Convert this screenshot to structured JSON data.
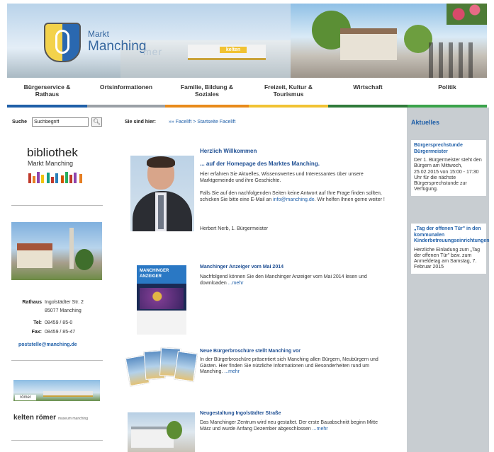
{
  "header": {
    "brand_small": "Markt",
    "brand_big": "Manching",
    "brand_ghost": "mer",
    "banner_tag": "kelten"
  },
  "nav": {
    "items": [
      {
        "label_line1": "Bürgerservice &",
        "label_line2": "Rathaus",
        "color": "#1f5fa8"
      },
      {
        "label_line1": "Ortsinformationen",
        "label_line2": "",
        "color": "#9aa0a6"
      },
      {
        "label_line1": "Familie, Bildung &",
        "label_line2": "Soziales",
        "color": "#e88a1a"
      },
      {
        "label_line1": "Freizeit, Kultur &",
        "label_line2": "Tourismus",
        "color": "#f1c232"
      },
      {
        "label_line1": "Wirtschaft",
        "label_line2": "",
        "color": "#2f7a3a"
      },
      {
        "label_line1": "Politik",
        "label_line2": "",
        "color": "#3aa34a"
      }
    ]
  },
  "search": {
    "label": "Suche",
    "value": "Suchbegriff",
    "button_icon": "search-icon"
  },
  "breadcrumb": {
    "label": "Sie sind hier:",
    "path": "»» Facelift  >  Startseite Facelift"
  },
  "library": {
    "title": "bibliothek",
    "subtitle": "Markt Manching"
  },
  "contact": {
    "rathaus_label": "Rathaus",
    "street": "Ingolstädter Str. 2",
    "city": "85077 Manching",
    "tel_label": "Tel:",
    "tel": "08459 / 85-0",
    "fax_label": "Fax:",
    "fax": "08459 / 85-47",
    "email": "poststelle@manching.de"
  },
  "kelten_roemer": {
    "sign": "römer",
    "brand": "kelten römer",
    "small": "museum manching"
  },
  "welcome": {
    "title": "Herzlich Willkommen",
    "subtitle": "... auf der Homepage des Marktes Manching.",
    "p1": "Hier erfahren Sie Aktuelles, Wissenswertes und Interessantes über unsere Marktgemeinde und ihre Geschichte.",
    "p2a": "Falls Sie auf den nachfolgenden Seiten keine Antwort auf Ihre Frage finden sollten, schicken Sie bitte eine E-Mail an",
    "p2_email": "info@manching.de",
    "p2b": ". Wir helfen Ihnen gerne weiter !",
    "signature": "Herbert Nerb, 1. Bürgermeister"
  },
  "news": [
    {
      "title": "Manchinger Anzeiger vom Mai 2014",
      "text": "Nachfolgend können Sie den Manchinger Anzeiger vom Mai 2014 lesen und downloaden",
      "more": "...mehr",
      "thumb_label": "MANCHINGER ANZEIGER"
    },
    {
      "title": "Neue Bürgerbroschüre stellt Manching vor",
      "text": "In der Bürgerbroschüre präsentiert sich Manching allen Bürgern, Neubürgern und Gästen. Hier finden Sie nützliche Informationen und Besonderheiten rund um Manching.",
      "more": "...mehr"
    },
    {
      "title": "Neugestaltung Ingolstädter Straße",
      "text": "Das Manchinger Zentrum wird neu gestaltet. Der erste Bauabschnitt beginn Mitte März und wurde Anfang Dezember abgeschlossen",
      "more": "...mehr"
    }
  ],
  "aktuelles": {
    "heading": "Aktuelles",
    "items": [
      {
        "title": "Bürgersprechstunde Bürgermeister",
        "text": "Der 1. Bürgermeister steht den Bürgern am Mittwoch, 25.02.2015 von 15:00 - 17:30 Uhr für die nächste Bürgersprechstunde zur Verfügung."
      },
      {
        "title": "„Tag der offenen Tür\" in den kommunalen Kinderbetreuungseinrichtungen",
        "text": "Herzliche Einladung zum „Tag der offenen Tür\" bzw. zum Anmeldetag am Samstag, 7. Februar 2015"
      }
    ]
  }
}
